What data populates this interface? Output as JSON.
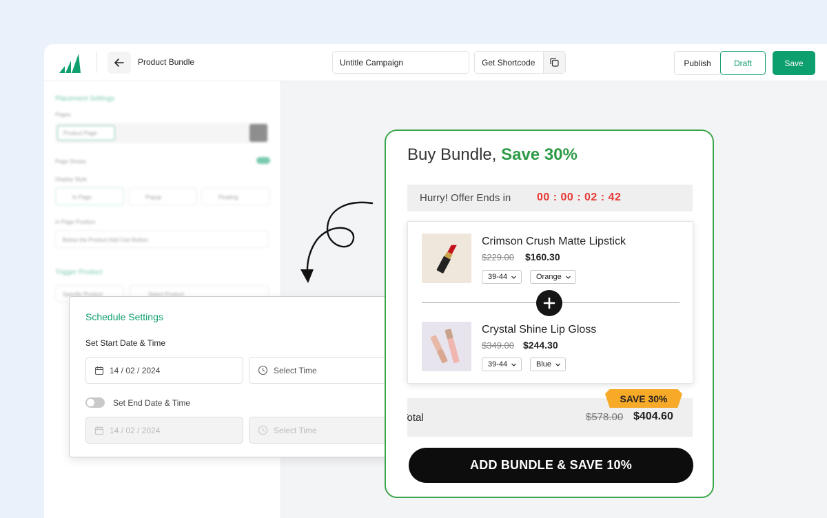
{
  "header": {
    "page_title": "Product Bundle",
    "campaign_name": "Untitle Campaign",
    "shortcode_label": "Get Shortcode",
    "publish_label": "Publish",
    "draft_label": "Draft",
    "save_label": "Save"
  },
  "sidebar": {
    "section1": "Placement Settings",
    "pages_label": "Pages",
    "pages_chip": "Product Page",
    "page_shows": "Page Shows",
    "display_style": "Display Style",
    "display_options": [
      "In Page",
      "Popup",
      "Floating"
    ],
    "position_label": "In Page Position",
    "position_value": "Below the Product Add Cart Button",
    "section2": "Trigger Product",
    "trigger_value": "Specific Product",
    "trigger_search": "Select Product"
  },
  "schedule": {
    "title": "Schedule Settings",
    "start_label": "Set Start Date & Time",
    "start_date": "14 / 02 / 2024",
    "start_time_placeholder": "Select Time",
    "end_toggle_label": "Set End Date & Time",
    "end_date": "14 / 02 / 2024",
    "end_time_placeholder": "Select Time"
  },
  "bundle": {
    "title_prefix": "Buy Bundle, ",
    "title_highlight": "Save 30%",
    "timer_label": "Hurry! Offer Ends in",
    "timer_value": "00 : 00 : 02 : 42",
    "products": [
      {
        "name": "Crimson Crush Matte Lipstick",
        "old_price": "$229.00",
        "new_price": "$160.30",
        "size": "39-44",
        "color": "Orange"
      },
      {
        "name": "Crystal Shine Lip Gloss",
        "old_price": "$349.00",
        "new_price": "$244.30",
        "size": "39-44",
        "color": "Blue"
      }
    ],
    "save_badge": "SAVE 30%",
    "total_label": "Total",
    "total_old": "$578.00",
    "total_new": "$404.60",
    "cta": "ADD BUNDLE & SAVE 10%"
  },
  "colors": {
    "brand_green": "#0e9f6e",
    "bundle_green": "#2e9b46",
    "timer_red": "#e53935",
    "badge_orange": "#f7a928"
  }
}
